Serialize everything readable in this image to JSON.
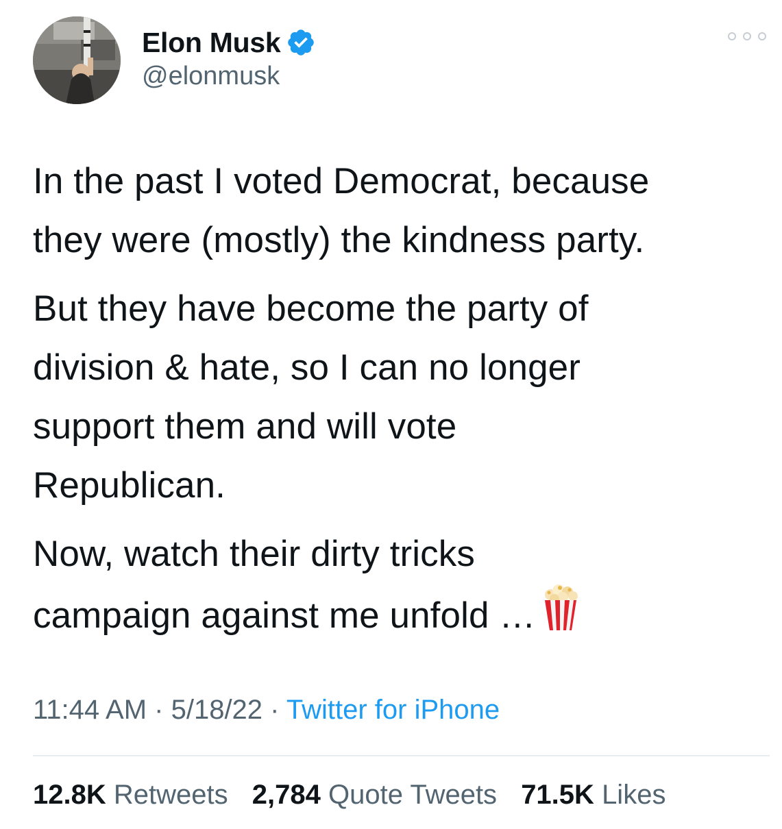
{
  "author": {
    "display_name": "Elon Musk",
    "handle": "@elonmusk",
    "verified": true,
    "avatar_icon": "profile-photo-avatar"
  },
  "tweet": {
    "paragraphs": [
      "In the past I voted Democrat, because\nthey were (mostly) the kindness party.",
      "But they have become the party of\ndivision & hate, so I can no longer\nsupport them and will vote\nRepublican.",
      "Now, watch their dirty tricks\ncampaign against me unfold …"
    ],
    "emoji_icon": "popcorn-icon"
  },
  "meta": {
    "time": "11:44 AM",
    "separator": " · ",
    "date": "5/18/22",
    "source": "Twitter for iPhone"
  },
  "stats": {
    "retweets_count": "12.8K",
    "retweets_label": "Retweets",
    "quotes_count": "2,784",
    "quotes_label": "Quote Tweets",
    "likes_count": "71.5K",
    "likes_label": "Likes"
  },
  "colors": {
    "text_primary": "#0f1419",
    "text_secondary": "#536471",
    "link_blue": "#1d9bf0",
    "verified_blue": "#1d9bf0",
    "divider": "#e6ecf0"
  }
}
